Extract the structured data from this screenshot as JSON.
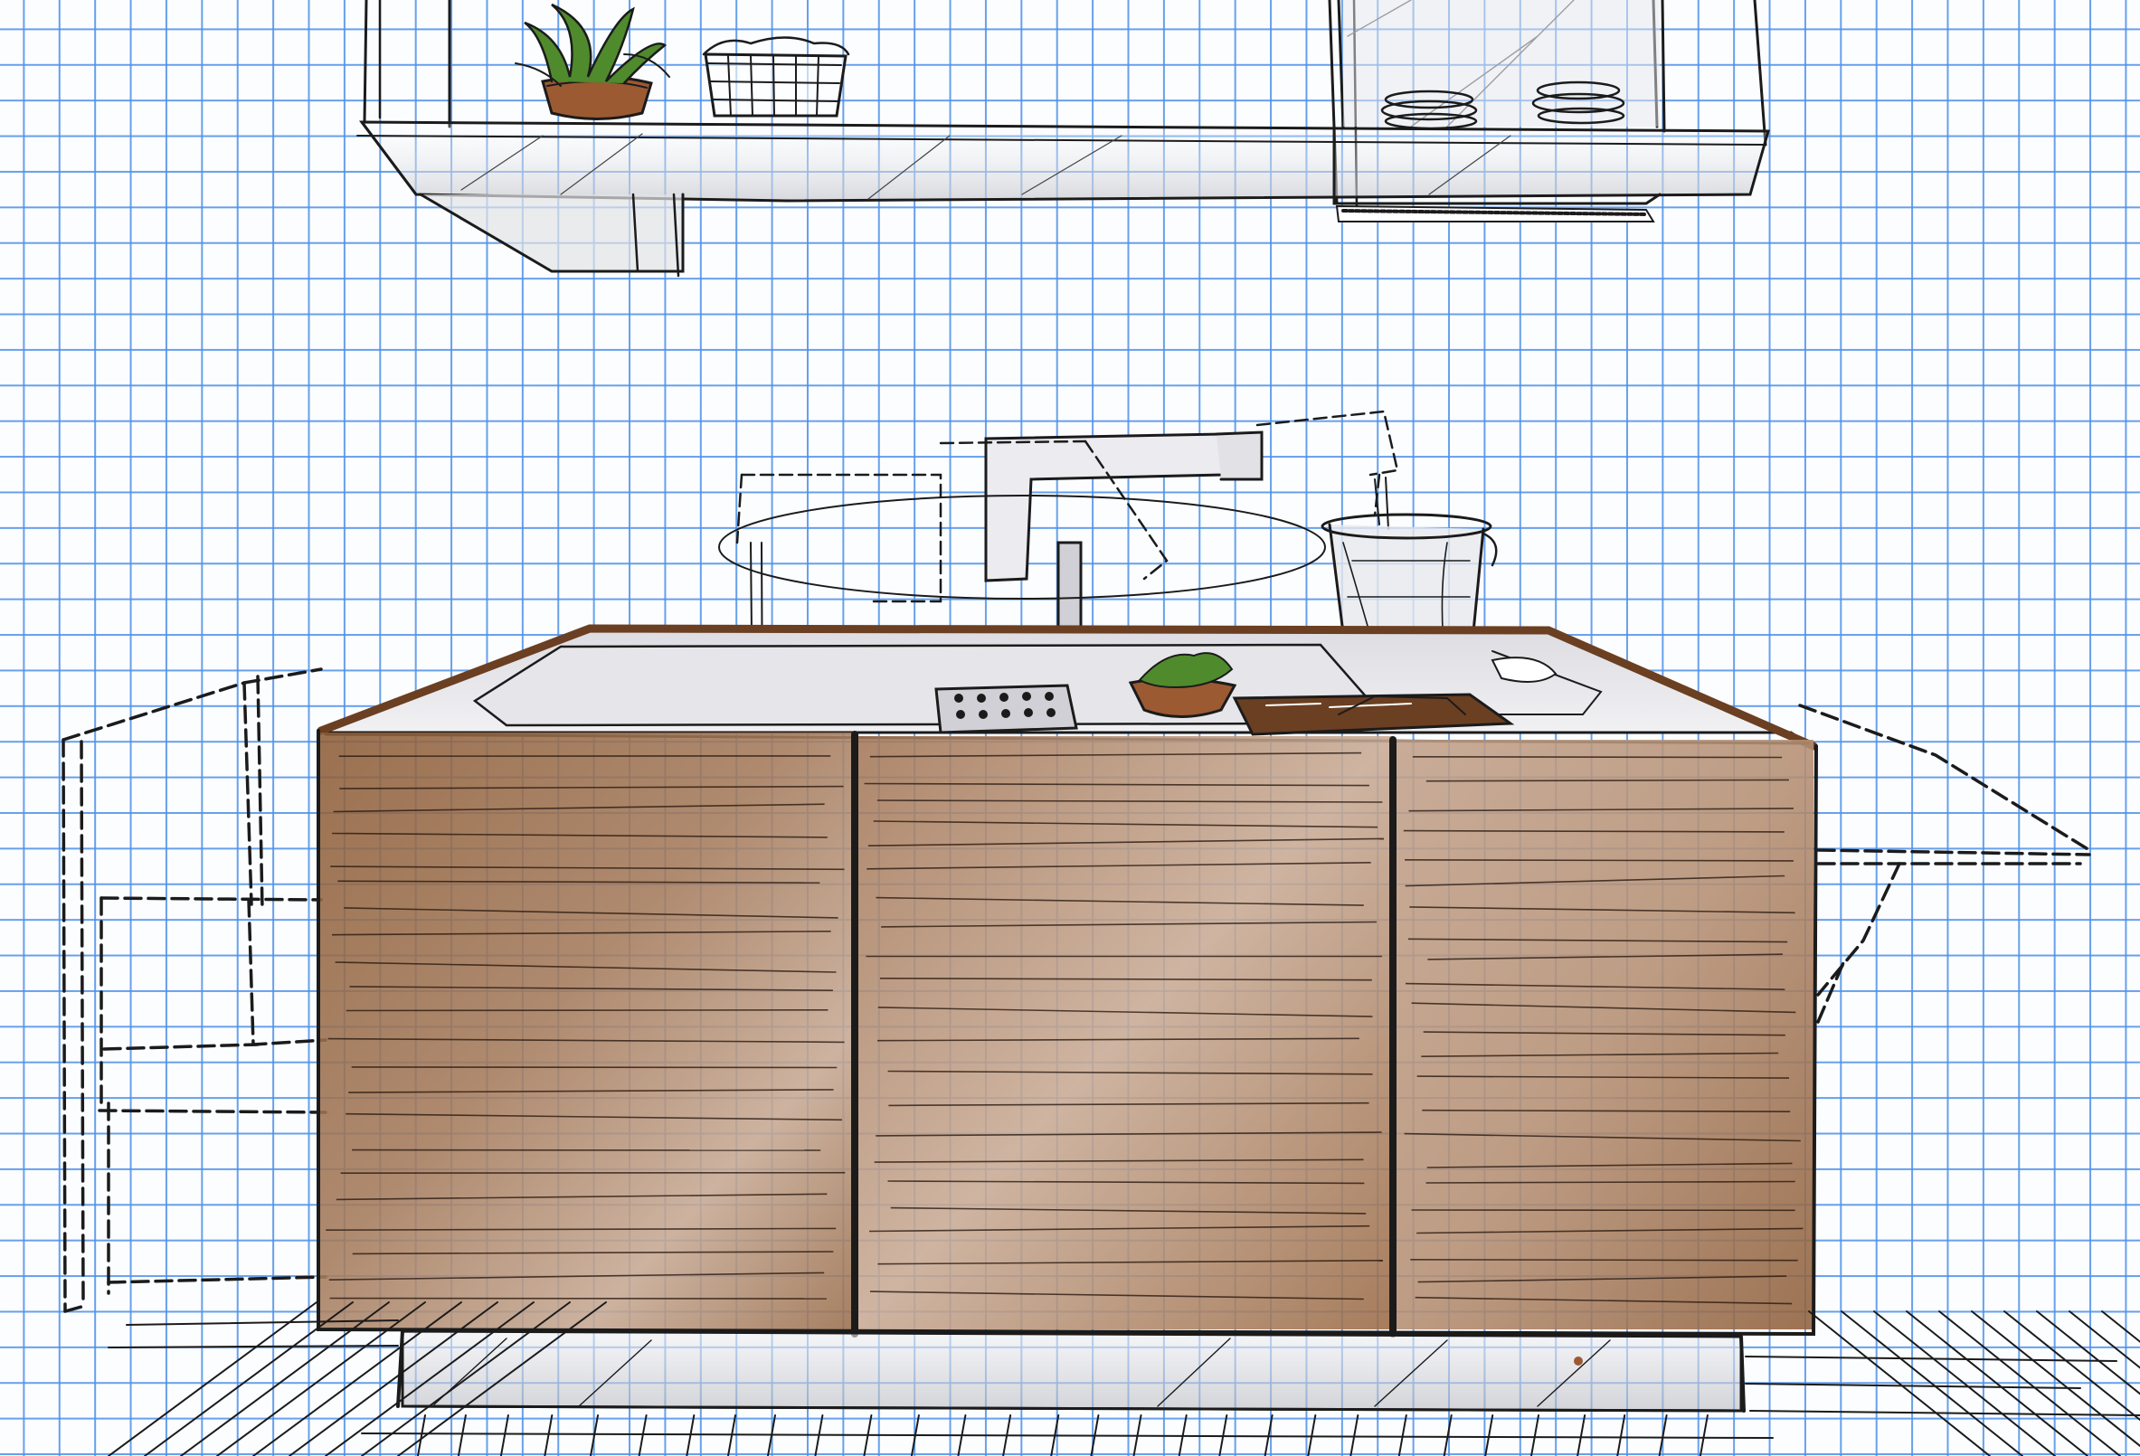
{
  "scene": {
    "subject": "kitchen-island-sketch",
    "colors": {
      "grid": "#4d90e8",
      "paper": "#fbfdff",
      "ink": "#1b1b1b",
      "wood_dark": "#8a5a34",
      "wood_light": "#c9ac95",
      "counter_top": "#6b3f22",
      "steel": "#d8d8dc",
      "plant": "#4f8a2c",
      "pot": "#9b5a32"
    }
  }
}
